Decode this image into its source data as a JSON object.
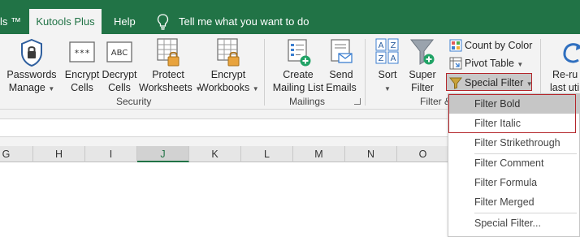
{
  "tabs": {
    "partial_left": "ls ™",
    "active": "Kutools Plus",
    "help": "Help",
    "tell_me": "Tell me what you want to do"
  },
  "ribbon": {
    "security": {
      "label": "Security",
      "buttons": [
        {
          "line1": "Passwords",
          "line2": "Manage",
          "icon": "padlock-shield-icon"
        },
        {
          "line1": "Encrypt",
          "line2": "Cells",
          "icon": "encrypt-icon"
        },
        {
          "line1": "Decrypt",
          "line2": "Cells",
          "icon": "decrypt-icon"
        },
        {
          "line1": "Protect",
          "line2": "Worksheets",
          "icon": "protect-sheet-icon"
        },
        {
          "line1": "Encrypt",
          "line2": "Workbooks",
          "icon": "encrypt-workbook-icon"
        }
      ],
      "encrypt_glyph": "***",
      "decrypt_glyph": "ABC"
    },
    "mailings": {
      "label": "Mailings",
      "buttons": [
        {
          "line1": "Create",
          "line2": "Mailing List",
          "icon": "mailing-list-icon"
        },
        {
          "line1": "Send",
          "line2": "Emails",
          "icon": "send-email-icon"
        }
      ]
    },
    "filter": {
      "label": "Filter &",
      "sort": {
        "line1": "Sort",
        "icon": "sort-icon"
      },
      "super_filter": {
        "line1": "Super",
        "line2": "Filter",
        "icon": "funnel-plus-icon"
      },
      "count_by_color": "Count by Color",
      "pivot_table": "Pivot Table",
      "special_filter": "Special Filter"
    },
    "rerun": {
      "line1": "Re-ru",
      "line2": "last uti"
    }
  },
  "columns": [
    "G",
    "H",
    "I",
    "J",
    "K",
    "L",
    "M",
    "N",
    "O"
  ],
  "active_column": "J",
  "dropdown": {
    "items": [
      "Filter Bold",
      "Filter Italic",
      "Filter Strikethrough",
      "Filter Comment",
      "Filter Formula",
      "Filter Merged",
      "Special Filter..."
    ],
    "highlighted": "Filter Bold"
  },
  "colors": {
    "excel_green": "#217346",
    "highlight_border": "#b4262b"
  }
}
